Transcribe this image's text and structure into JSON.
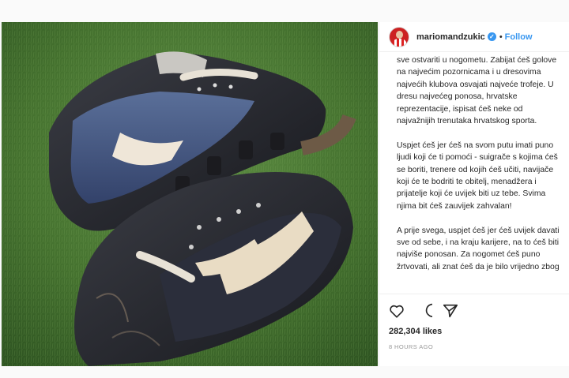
{
  "post": {
    "username": "mariomandzukic",
    "verified_icon": "verified-badge-icon",
    "separator": "•",
    "follow_label": "Follow",
    "caption": [
      "sve ostvariti u nogometu. Zabijat ćeš golove na najvećim pozornicama i u dresovima najvećih klubova osvajati najveće trofeje. U dresu najvećeg ponosa, hrvatske reprezentacije, ispisat ćeš neke od najvažnijih trenutaka hrvatskog sporta.",
      "Uspjet ćeš jer ćeš na svom putu imati puno ljudi koji će ti pomoći - suigrače s kojima ćeš se boriti, trenere od kojih ćeš učiti, navijače koji će te bodriti te obitelj, menadžera i prijatelje koji će uvijek biti uz tebe. Svima njima bit ćeš zauvijek zahvalan!",
      "A prije svega, uspjet ćeš jer ćeš uvijek davati sve od sebe, i na kraju karijere, na to ćeš biti najviše ponosan. Za nogomet ćeš puno žrtvovati, ali znat ćeš da je bilo vrijedno zbog"
    ],
    "likes": "282,304 likes",
    "time": "8 HOURS AGO"
  },
  "icons": {
    "like": "heart-icon",
    "comment": "comment-icon",
    "share": "share-icon",
    "avatar": "avatar"
  },
  "colors": {
    "accent": "#3897f0",
    "text": "#262626",
    "muted": "#999999",
    "grass": "#4a7a35"
  }
}
